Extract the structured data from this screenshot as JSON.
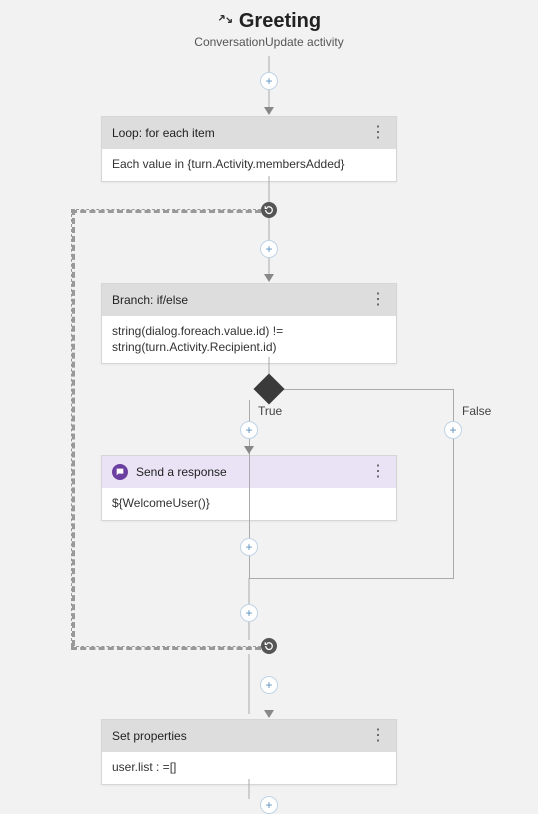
{
  "title": "Greeting",
  "subtitle": "ConversationUpdate activity",
  "loop": {
    "header": "Loop: for each item",
    "body": "Each value in {turn.Activity.membersAdded}"
  },
  "branch": {
    "header": "Branch: if/else",
    "body": "string(dialog.foreach.value.id) != string(turn.Activity.Recipient.id)",
    "true_label": "True",
    "false_label": "False"
  },
  "response": {
    "header": "Send a response",
    "body": "${WelcomeUser()}"
  },
  "setprops": {
    "header": "Set properties",
    "body": "user.list : =[]"
  }
}
